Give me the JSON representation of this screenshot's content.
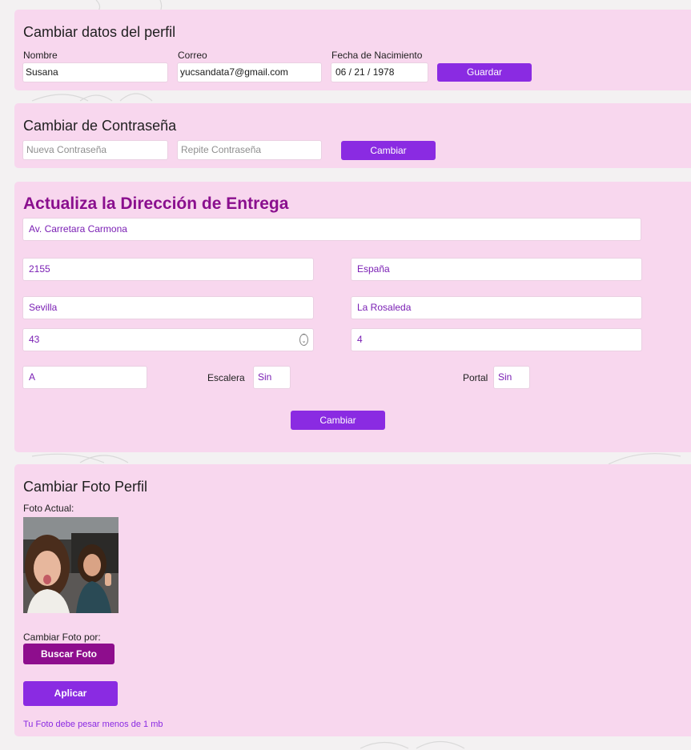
{
  "profile": {
    "title": "Cambiar datos del perfil",
    "name_label": "Nombre",
    "name_value": "Susana",
    "email_label": "Correo",
    "email_value": "yucsandata7@gmail.com",
    "birth_label": "Fecha de Nacimiento",
    "birth_value": "06 / 21 / 1978",
    "save_label": "Guardar"
  },
  "password": {
    "title": "Cambiar de Contraseña",
    "new_placeholder": "Nueva Contraseña",
    "repeat_placeholder": "Repite Contraseña",
    "change_label": "Cambiar"
  },
  "address": {
    "title": "Actualiza la Dirección de Entrega",
    "street": "Av. Carretara Carmona",
    "number": "2155",
    "country": "España",
    "city": "Sevilla",
    "district": "La Rosaleda",
    "floor": "43",
    "floor2": "4",
    "door": "A",
    "stair_label": "Escalera",
    "stair_value": "Sin",
    "portal_label": "Portal",
    "portal_value": "Sin",
    "change_label": "Cambiar"
  },
  "photo": {
    "title": "Cambiar Foto Perfil",
    "current_label": "Foto Actual:",
    "change_by_label": "Cambiar Foto por:",
    "browse_label": "Buscar Foto",
    "apply_label": "Aplicar",
    "note": "Tu Foto debe pesar menos de 1 mb"
  },
  "colors": {
    "card_bg": "#f8d7ee",
    "button": "#8a2be2",
    "button_dark": "#8e0d8d",
    "heading_accent": "#8a0f8e"
  }
}
